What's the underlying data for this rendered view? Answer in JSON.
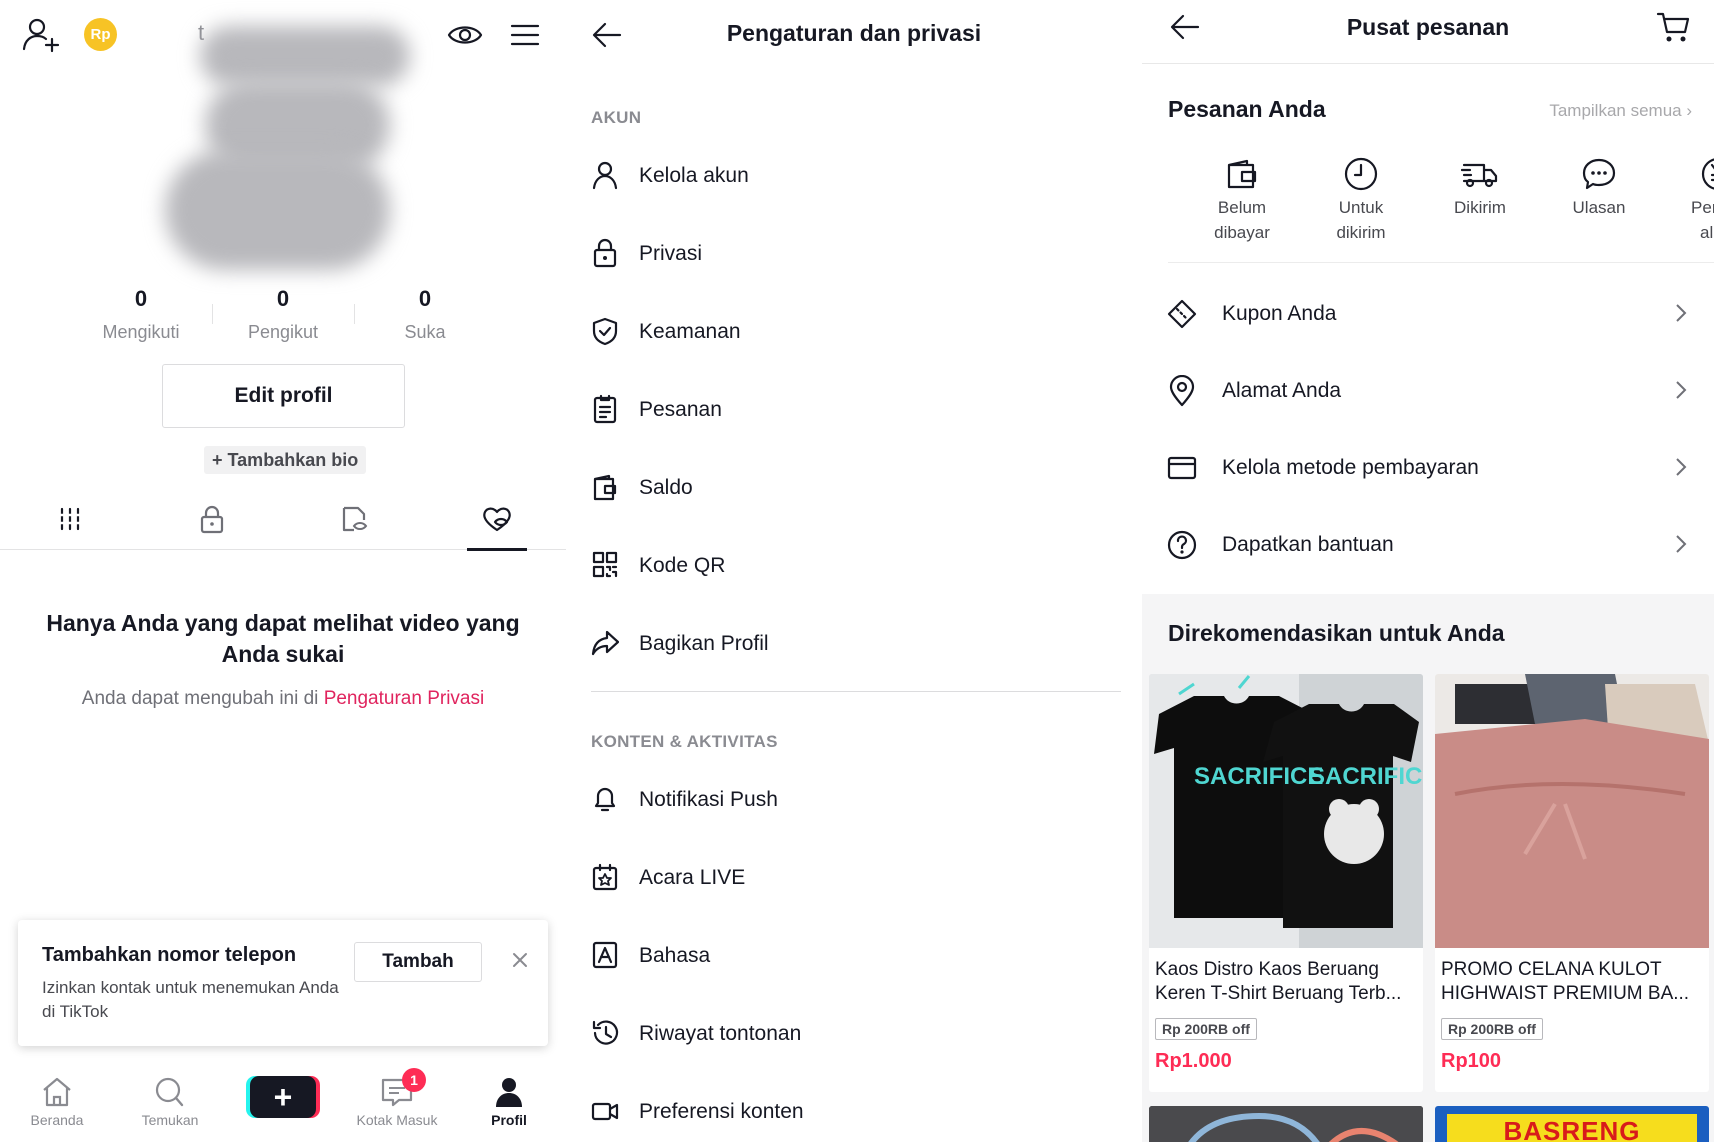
{
  "colors": {
    "accent": "#fe2c55",
    "link": "#e0245e",
    "text": "#161823",
    "muted": "#8a8b91",
    "coin": "#f7c325"
  },
  "profile": {
    "coin_label": "Rp",
    "username_partial": "t",
    "stats": [
      {
        "value": "0",
        "label": "Mengikuti"
      },
      {
        "value": "0",
        "label": "Pengikut"
      },
      {
        "value": "0",
        "label": "Suka"
      }
    ],
    "edit_button": "Edit profil",
    "add_bio": "+ Tambahkan bio",
    "tabs": [
      "videos-grid-icon",
      "lock-icon",
      "repost-icon",
      "liked-heart-icon"
    ],
    "empty_title": "Hanya Anda yang dapat melihat video yang Anda sukai",
    "empty_sub_prefix": "Anda dapat mengubah ini di ",
    "empty_sub_link": "Pengaturan Privasi",
    "toast": {
      "title": "Tambahkan nomor telepon",
      "subtitle": "Izinkan kontak untuk menemukan Anda di TikTok",
      "button": "Tambah"
    },
    "nav": [
      {
        "label": "Beranda",
        "icon": "home-icon"
      },
      {
        "label": "Temukan",
        "icon": "search-icon"
      },
      {
        "label": "+",
        "icon": "create-icon"
      },
      {
        "label": "Kotak Masuk",
        "icon": "inbox-icon",
        "badge": "1"
      },
      {
        "label": "Profil",
        "icon": "profile-icon",
        "active": true
      }
    ]
  },
  "settings": {
    "title": "Pengaturan dan privasi",
    "section_account": "AKUN",
    "account_items": [
      {
        "label": "Kelola akun",
        "icon": "user-icon"
      },
      {
        "label": "Privasi",
        "icon": "lock-icon"
      },
      {
        "label": "Keamanan",
        "icon": "shield-icon"
      },
      {
        "label": "Pesanan",
        "icon": "order-list-icon"
      },
      {
        "label": "Saldo",
        "icon": "wallet-icon"
      },
      {
        "label": "Kode QR",
        "icon": "qr-code-icon"
      },
      {
        "label": "Bagikan Profil",
        "icon": "share-icon"
      }
    ],
    "section_content": "KONTEN & AKTIVITAS",
    "content_items": [
      {
        "label": "Notifikasi Push",
        "icon": "bell-icon"
      },
      {
        "label": "Acara LIVE",
        "icon": "calendar-star-icon"
      },
      {
        "label": "Bahasa",
        "icon": "language-icon"
      },
      {
        "label": "Riwayat tontonan",
        "icon": "history-icon"
      },
      {
        "label": "Preferensi konten",
        "icon": "video-camera-icon"
      }
    ]
  },
  "orders": {
    "title": "Pusat pesanan",
    "section_title": "Pesanan Anda",
    "see_all": "Tampilkan semua",
    "statuses": [
      {
        "line1": "Belum",
        "line2": "dibayar",
        "icon": "wallet-icon"
      },
      {
        "line1": "Untuk",
        "line2": "dikirim",
        "icon": "clock-icon"
      },
      {
        "line1": "Dikirim",
        "line2": "",
        "icon": "truck-icon"
      },
      {
        "line1": "Ulasan",
        "line2": "",
        "icon": "chat-bubble-icon"
      },
      {
        "line1": "Pengeı",
        "line2": "alian",
        "icon": "refund-icon"
      }
    ],
    "menu": [
      {
        "label": "Kupon Anda",
        "icon": "coupon-icon"
      },
      {
        "label": "Alamat Anda",
        "icon": "location-pin-icon"
      },
      {
        "label": "Kelola metode pembayaran",
        "icon": "card-icon"
      },
      {
        "label": "Dapatkan bantuan",
        "icon": "help-circle-icon"
      }
    ],
    "recommend_title": "Direkomendasikan untuk Anda",
    "products": [
      {
        "name": "Kaos Distro Kaos Beruang Keren T-Shirt Beruang Terb...",
        "coupon": "Rp 200RB off",
        "price": "Rp1.000",
        "image_text": "SACRIFICE"
      },
      {
        "name": "PROMO CELANA KULOT HIGHWAIST PREMIUM BA...",
        "coupon": "Rp 200RB off",
        "price": "Rp100"
      }
    ],
    "next_banner": "BASRENG"
  }
}
